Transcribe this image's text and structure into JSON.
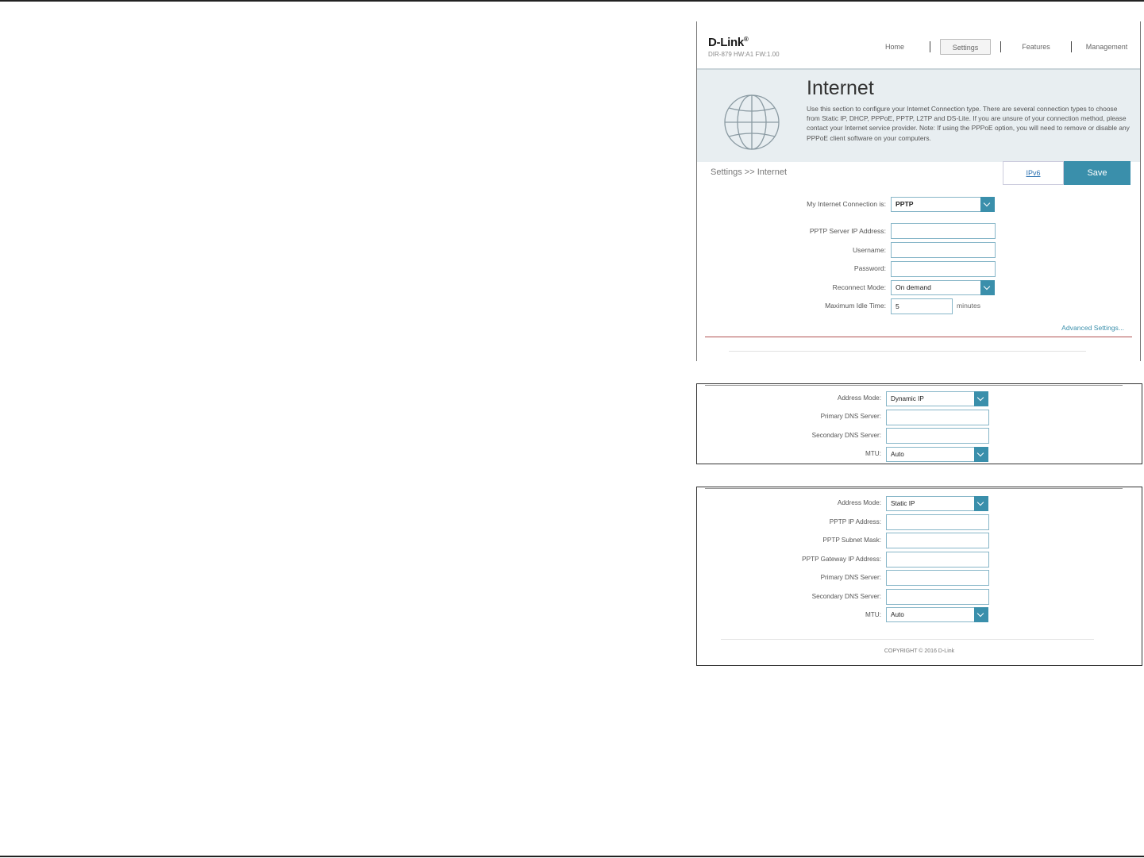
{
  "brand": {
    "logo": "D-Link",
    "logo_mark": "®",
    "model": "DIR-879 HW:A1 FW:1.00"
  },
  "nav": {
    "home": "Home",
    "settings": "Settings",
    "features": "Features",
    "management": "Management"
  },
  "hero": {
    "title": "Internet",
    "description": "Use this section to configure your Internet Connection type. There are several connection types to choose from Static IP, DHCP, PPPoE, PPTP, L2TP and DS-Lite. If you are unsure of your connection method, please contact your Internet service provider. Note: If using the PPPoE option, you will need to remove or disable any PPPoE client software on your computers."
  },
  "toolbar": {
    "breadcrumb": "Settings >> Internet",
    "ipv6_link": "IPv6",
    "save_label": "Save"
  },
  "form": {
    "connection_label": "My Internet Connection is:",
    "connection_value": "PPTP",
    "server_ip_label": "PPTP Server IP Address:",
    "server_ip_value": "",
    "username_label": "Username:",
    "username_value": "",
    "password_label": "Password:",
    "password_value": "",
    "reconnect_label": "Reconnect Mode:",
    "reconnect_value": "On demand",
    "idle_label": "Maximum Idle Time:",
    "idle_value": "5",
    "idle_unit": "minutes",
    "advanced_link": "Advanced Settings..."
  },
  "dynamic_panel": {
    "address_mode_label": "Address Mode:",
    "address_mode_value": "Dynamic IP",
    "primary_dns_label": "Primary DNS Server:",
    "primary_dns_value": "",
    "secondary_dns_label": "Secondary DNS Server:",
    "secondary_dns_value": "",
    "mtu_label": "MTU:",
    "mtu_value": "Auto"
  },
  "static_panel": {
    "address_mode_label": "Address Mode:",
    "address_mode_value": "Static IP",
    "pptp_ip_label": "PPTP IP Address:",
    "pptp_ip_value": "",
    "subnet_label": "PPTP Subnet Mask:",
    "subnet_value": "",
    "gateway_label": "PPTP Gateway IP Address:",
    "gateway_value": "",
    "primary_dns_label": "Primary DNS Server:",
    "primary_dns_value": "",
    "secondary_dns_label": "Secondary DNS Server:",
    "secondary_dns_value": "",
    "mtu_label": "MTU:",
    "mtu_value": "Auto",
    "copyright": "COPYRIGHT © 2016 D-Link"
  },
  "colors": {
    "accent": "#3a8fab",
    "hero_bg": "#e8eef1",
    "link": "#2a70b0",
    "divider_red": "#b05050"
  },
  "icons": [
    "globe-icon",
    "chevron-down-icon"
  ]
}
